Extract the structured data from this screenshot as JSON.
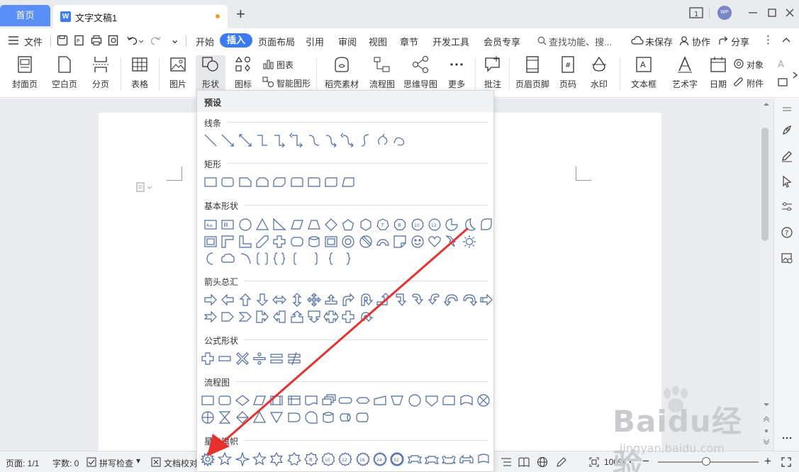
{
  "titlebar": {
    "home_tab": "首页",
    "doc_tab": "文字文稿1",
    "avatar_text": "WP"
  },
  "menu": {
    "file": "文件",
    "items": [
      "开始",
      "插入",
      "页面布局",
      "引用",
      "审阅",
      "视图",
      "章节",
      "开发工具",
      "会员专享"
    ],
    "active": "插入",
    "search_placeholder": "查找功能、搜...",
    "unsaved": "未保存",
    "collab": "协作",
    "share": "分享"
  },
  "ribbon": {
    "cover": "封面页",
    "blank": "空白页",
    "pagebreak": "分页",
    "table": "表格",
    "picture": "图片",
    "shapes": "形状",
    "icons": "图标",
    "chart": "图表",
    "smart": "智能图形",
    "material": "稻壳素材",
    "flowchart": "流程图",
    "mindmap": "思维导图",
    "more": "更多",
    "comment": "批注",
    "headerfooter": "页眉页脚",
    "pagenum": "页码",
    "watermark": "水印",
    "textbox": "文本框",
    "wordart": "艺术字",
    "date": "日期",
    "object": "对象",
    "attachment": "附件"
  },
  "dropdown": {
    "header": "预设",
    "sections": [
      "线条",
      "矩形",
      "基本形状",
      "箭头总汇",
      "公式形状",
      "流程图",
      "星与旗帜"
    ]
  },
  "status": {
    "page": "页面: 1/1",
    "words": "字数: 0",
    "spell": "拼写检查",
    "proof": "文档校对",
    "zoom": "100%"
  },
  "watermark": {
    "big": "Baidu经验",
    "small": "jingyan.baidu.com"
  },
  "colors": {
    "accent": "#3a7bf5",
    "arrow": "#e8312f",
    "shape_stroke": "#4a6aa6"
  }
}
